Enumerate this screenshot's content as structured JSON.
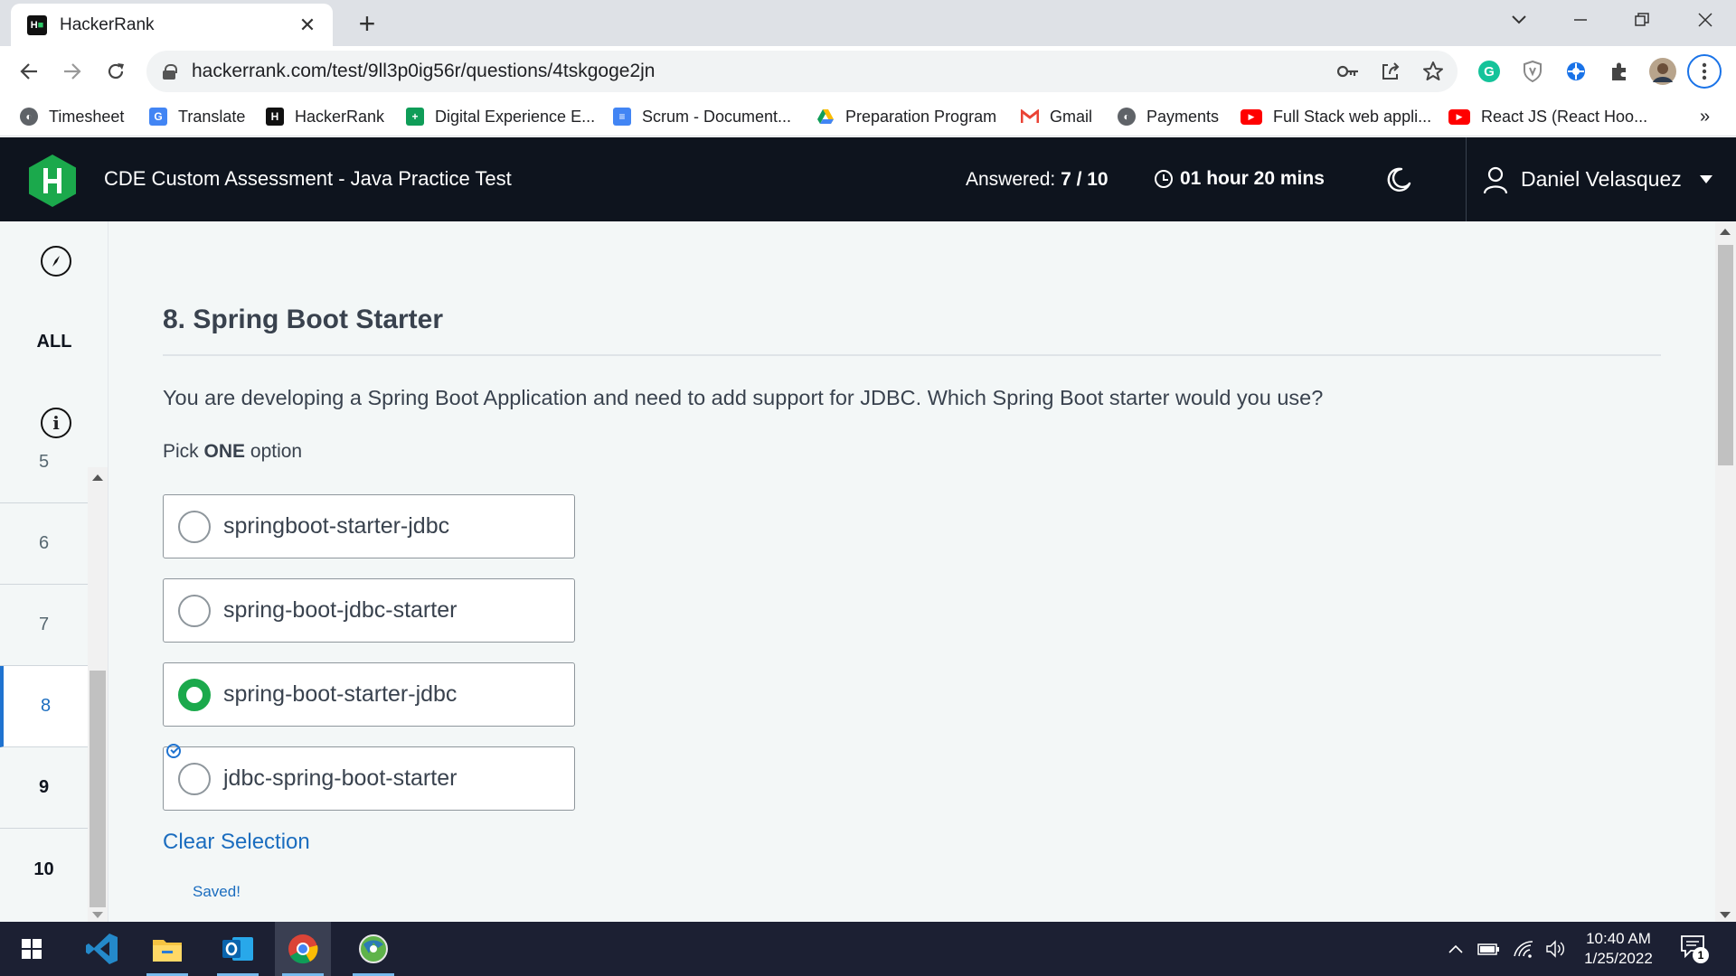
{
  "browser": {
    "tab_title": "HackerRank",
    "tab_close": "✕",
    "new_tab": "+",
    "url": "hackerrank.com/test/9ll3p0ig56r/questions/4tskgoge2jn",
    "bookmarks": [
      {
        "label": "Timesheet",
        "icon": "globe-icon",
        "color": "#5f6368"
      },
      {
        "label": "Translate",
        "icon": "translate-icon",
        "color": "#4285f4"
      },
      {
        "label": "HackerRank",
        "icon": "hackerrank-icon",
        "color": "#111111"
      },
      {
        "label": "Digital Experience E...",
        "icon": "sheets-icon",
        "color": "#0f9d58"
      },
      {
        "label": "Scrum - Document...",
        "icon": "docs-icon",
        "color": "#4285f4"
      },
      {
        "label": "Preparation Program",
        "icon": "drive-icon",
        "color": "#fbbc04"
      },
      {
        "label": "Gmail",
        "icon": "gmail-icon",
        "color": "#ea4335"
      },
      {
        "label": "Payments",
        "icon": "globe-icon",
        "color": "#5f6368"
      },
      {
        "label": "Full Stack web appli...",
        "icon": "youtube-icon",
        "color": "#ff0000"
      },
      {
        "label": "React JS (React Hoo...",
        "icon": "youtube-icon",
        "color": "#ff0000"
      }
    ],
    "bookmarks_more": "»"
  },
  "header": {
    "test_title": "CDE Custom Assessment - Java Practice Test",
    "answered_label": "Answered:",
    "answered_value": "7 / 10",
    "timer": "01 hour 20 mins",
    "user_name": "Daniel Velasquez"
  },
  "rail": {
    "all_label": "ALL",
    "info_glyph": "i",
    "items": [
      {
        "label": "5",
        "state": "normal"
      },
      {
        "label": "6",
        "state": "normal"
      },
      {
        "label": "7",
        "state": "normal"
      },
      {
        "label": "8",
        "state": "active"
      },
      {
        "label": "9",
        "state": "bold"
      },
      {
        "label": "10",
        "state": "bold"
      }
    ]
  },
  "question": {
    "title": "8. Spring Boot Starter",
    "text": "You are developing a Spring Boot Application and need to add support for JDBC. Which Spring Boot starter would you use?",
    "pick_prefix": "Pick",
    "pick_strong": "ONE",
    "pick_suffix": "option",
    "options": [
      {
        "label": "springboot-starter-jdbc",
        "selected": false
      },
      {
        "label": "spring-boot-jdbc-starter",
        "selected": false
      },
      {
        "label": "spring-boot-starter-jdbc",
        "selected": true
      },
      {
        "label": "jdbc-spring-boot-starter",
        "selected": false
      }
    ],
    "clear_label": "Clear Selection",
    "saved_label": "Saved!"
  },
  "taskbar": {
    "time": "10:40 AM",
    "date": "1/25/2022",
    "notification_count": "1"
  },
  "colors": {
    "header_bg": "#0e141e",
    "brand_green": "#1ba94c",
    "link_blue": "#1b6dbf"
  }
}
